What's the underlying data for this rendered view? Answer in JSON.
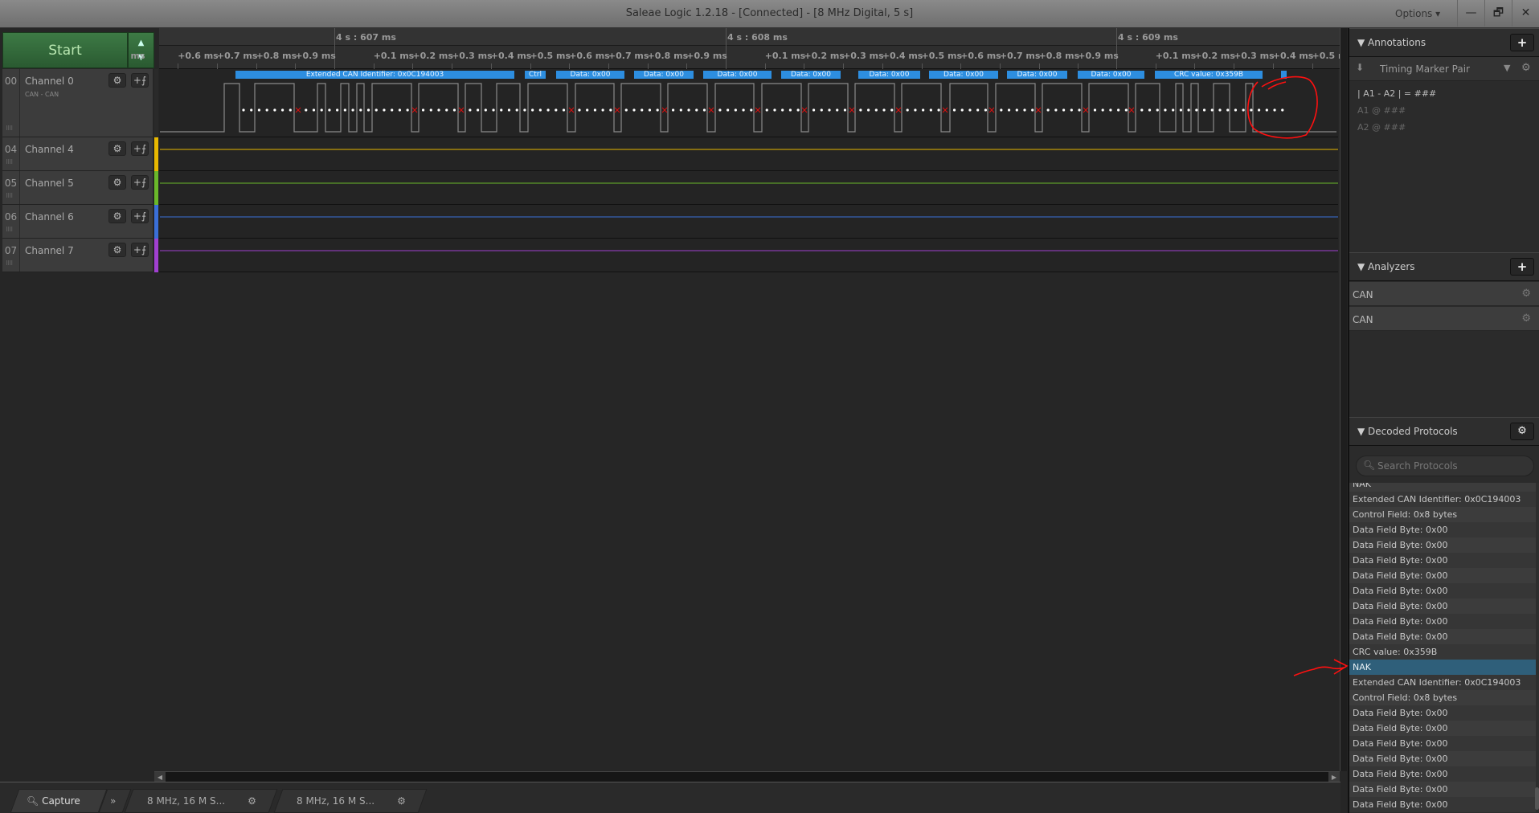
{
  "window": {
    "title": "Saleae Logic 1.2.18 - [Connected] - [8 MHz Digital, 5 s]",
    "options_label": "Options ▾",
    "minimize": "—",
    "restore": "🗗",
    "close": "✕"
  },
  "start": {
    "label": "Start",
    "up": "▲",
    "down": "▼"
  },
  "ruler": {
    "major": [
      "4 s : 607 ms",
      "4 s : 608 ms",
      "4 s : 609 ms"
    ],
    "minor_before": [
      "ms",
      "+0.6 ms",
      "+0.7 ms",
      "+0.8 ms",
      "+0.9 ms"
    ],
    "minor": [
      "+0.1 ms",
      "+0.2 ms",
      "+0.3 ms",
      "+0.4 ms",
      "+0.5 ms",
      "+0.6 ms",
      "+0.7 ms",
      "+0.8 ms",
      "+0.9 ms"
    ],
    "minor_last": [
      "+0.1 ms",
      "+0.2 ms",
      "+0.3 ms",
      "+0.4 ms",
      "+0.5 m"
    ]
  },
  "channels": [
    {
      "num": "00",
      "name": "Channel 0",
      "sub": "CAN - CAN",
      "color": "#888888"
    },
    {
      "num": "04",
      "name": "Channel 4",
      "color": "#e8b800"
    },
    {
      "num": "05",
      "name": "Channel 5",
      "color": "#6ab82a"
    },
    {
      "num": "06",
      "name": "Channel 6",
      "color": "#3a6fd8"
    },
    {
      "num": "07",
      "name": "Channel 7",
      "color": "#a040d0"
    }
  ],
  "channel_buttons": {
    "settings": "⚙",
    "trigger": "+⨍",
    "grip": "⠿⠿"
  },
  "annotations_bar": [
    "Extended CAN Identifier: 0x0C194003",
    "Ctrl",
    "Data: 0x00",
    "Data: 0x00",
    "Data: 0x00",
    "Data: 0x00",
    "Data: 0x00",
    "Data: 0x00",
    "Data: 0x00",
    "Data: 0x00",
    "CRC value: 0x359B",
    ""
  ],
  "annotations_panel": {
    "title": "Annotations",
    "add": "+",
    "marker": "Timing Marker Pair",
    "formula": "| A1 - A2 | = ###",
    "a1": "A1  @  ###",
    "a2": "A2  @  ###"
  },
  "analyzers": {
    "title": "Analyzers",
    "add": "+",
    "items": [
      "CAN",
      "CAN"
    ]
  },
  "decoded": {
    "title": "Decoded Protocols",
    "search_placeholder": "Search Protocols",
    "rows": [
      "NAK",
      "Extended CAN Identifier: 0x0C194003",
      "Control Field: 0x8 bytes",
      "Data Field Byte: 0x00",
      "Data Field Byte: 0x00",
      "Data Field Byte: 0x00",
      "Data Field Byte: 0x00",
      "Data Field Byte: 0x00",
      "Data Field Byte: 0x00",
      "Data Field Byte: 0x00",
      "Data Field Byte: 0x00",
      "CRC value: 0x359B",
      "NAK",
      "Extended CAN Identifier: 0x0C194003",
      "Control Field: 0x8 bytes",
      "Data Field Byte: 0x00",
      "Data Field Byte: 0x00",
      "Data Field Byte: 0x00",
      "Data Field Byte: 0x00",
      "Data Field Byte: 0x00",
      "Data Field Byte: 0x00",
      "Data Field Byte: 0x00"
    ],
    "selected_index": 12
  },
  "tabs": {
    "capture": "Capture",
    "more": "»",
    "session1": "8 MHz, 16 M S...",
    "session2": "8 MHz, 16 M S..."
  },
  "colors": {
    "accent": "#2d8ee0",
    "selected_row": "#2f5f7a",
    "start_green": "#3d7a45",
    "annotation_red": "#ff1010"
  }
}
